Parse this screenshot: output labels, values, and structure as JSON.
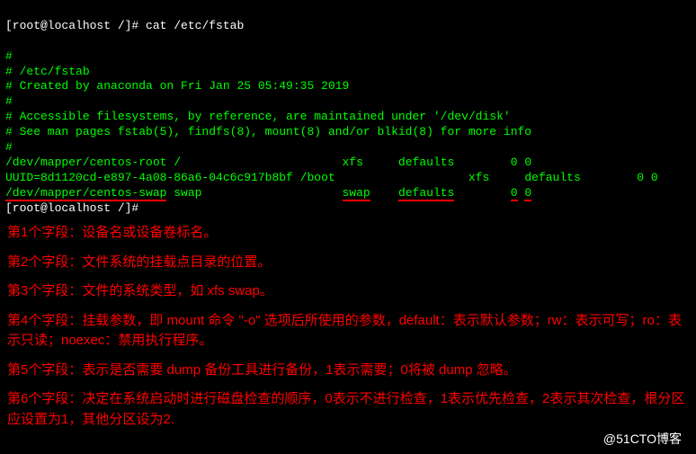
{
  "prompt1": {
    "user": "[root@localhost /]#",
    "command": "cat /etc/fstab"
  },
  "fstab": {
    "blank1": "",
    "comment1": "#",
    "comment2": "# /etc/fstab",
    "comment3": "# Created by anaconda on Fri Jan 25 05:49:35 2019",
    "comment4": "#",
    "comment5": "# Accessible filesystems, by reference, are maintained under '/dev/disk'",
    "comment6": "# See man pages fstab(5), findfs(8), mount(8) and/or blkid(8) for more info",
    "comment7": "#",
    "row1": {
      "device": "/dev/mapper/centos-root",
      "mount": "/",
      "fstype": "xfs",
      "options": "defaults",
      "dump": "0",
      "pass": "0"
    },
    "row2": {
      "device": "UUID=8d1120cd-e897-4a08-86a6-04c6c917b8bf",
      "mount": "/boot",
      "fstype": "xfs",
      "options": "defaults",
      "dump": "0",
      "pass": "0"
    },
    "row3": {
      "device": "/dev/mapper/centos-swap",
      "mount": "swap",
      "fstype": "swap",
      "options": "defaults",
      "dump": "0",
      "pass": "0"
    }
  },
  "prompt2": {
    "user": "[root@localhost /]#"
  },
  "annotations": {
    "field1": "第1个字段：设备名或设备卷标名。",
    "field2": "第2个字段：文件系统的挂载点目录的位置。",
    "field3": "第3个字段：文件的系统类型，如 xfs  swap。",
    "field4": "第4个字段：挂载参数，即 mount 命令 \"-o\" 选项后所使用的参数，default：表示默认参数；rw：表示可写；ro：表示只读；noexec：禁用执行程序。",
    "field5": "第5个字段：表示是否需要 dump 备份工具进行备份，1表示需要；0将被 dump 忽略。",
    "field6": "第6个字段：决定在系统启动时进行磁盘检查的顺序，0表示不进行检查，1表示优先检查，2表示其次检查，根分区应设置为1，其他分区设为2."
  },
  "watermark": "@51CTO博客"
}
